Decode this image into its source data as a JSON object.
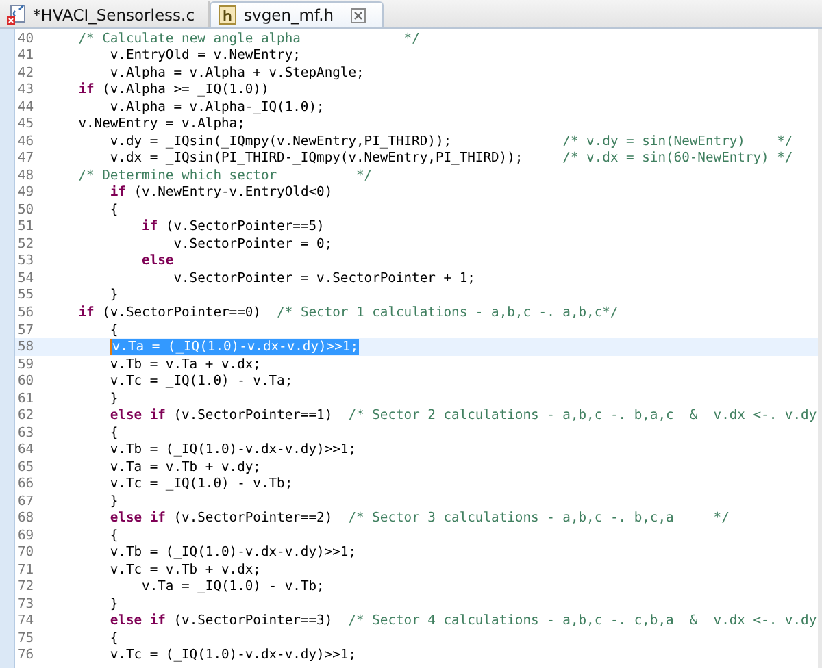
{
  "tabs": [
    {
      "label": "*HVACI_Sensorless.c",
      "selected": false
    },
    {
      "label": "svgen_mf.h",
      "selected": true
    }
  ],
  "editor": {
    "lines": [
      {
        "number": "40",
        "current": false,
        "segments": [
          {
            "kind": "comment",
            "text": "    /* Calculate new angle alpha             */"
          }
        ]
      },
      {
        "number": "41",
        "current": false,
        "segments": [
          {
            "kind": "code",
            "text": "        v.EntryOld = v.NewEntry;"
          }
        ]
      },
      {
        "number": "42",
        "current": false,
        "segments": [
          {
            "kind": "code",
            "text": "        v.Alpha = v.Alpha + v.StepAngle;"
          }
        ]
      },
      {
        "number": "43",
        "current": false,
        "segments": [
          {
            "kind": "keyword",
            "text": "    if"
          },
          {
            "kind": "code",
            "text": " (v.Alpha >= _IQ(1.0))"
          }
        ]
      },
      {
        "number": "44",
        "current": false,
        "segments": [
          {
            "kind": "code",
            "text": "        v.Alpha = v.Alpha-_IQ(1.0);"
          }
        ]
      },
      {
        "number": "45",
        "current": false,
        "segments": [
          {
            "kind": "code",
            "text": "    v.NewEntry = v.Alpha;"
          }
        ]
      },
      {
        "number": "46",
        "current": false,
        "segments": [
          {
            "kind": "code",
            "text": "        v.dy = _IQsin(_IQmpy(v.NewEntry,PI_THIRD));              "
          },
          {
            "kind": "comment",
            "text": "/* v.dy = sin(NewEntry)    */"
          }
        ]
      },
      {
        "number": "47",
        "current": false,
        "segments": [
          {
            "kind": "code",
            "text": "        v.dx = _IQsin(PI_THIRD-_IQmpy(v.NewEntry,PI_THIRD));     "
          },
          {
            "kind": "comment",
            "text": "/* v.dx = sin(60-NewEntry) */"
          }
        ]
      },
      {
        "number": "48",
        "current": false,
        "segments": [
          {
            "kind": "comment",
            "text": "    /* Determine which sector          */"
          }
        ]
      },
      {
        "number": "49",
        "current": false,
        "segments": [
          {
            "kind": "keyword",
            "text": "        if"
          },
          {
            "kind": "code",
            "text": " (v.NewEntry-v.EntryOld<0)"
          }
        ]
      },
      {
        "number": "50",
        "current": false,
        "segments": [
          {
            "kind": "code",
            "text": "        {"
          }
        ]
      },
      {
        "number": "51",
        "current": false,
        "segments": [
          {
            "kind": "keyword",
            "text": "            if"
          },
          {
            "kind": "code",
            "text": " (v.SectorPointer==5)"
          }
        ]
      },
      {
        "number": "52",
        "current": false,
        "segments": [
          {
            "kind": "code",
            "text": "                v.SectorPointer = 0;"
          }
        ]
      },
      {
        "number": "53",
        "current": false,
        "segments": [
          {
            "kind": "keyword",
            "text": "            else"
          }
        ]
      },
      {
        "number": "54",
        "current": false,
        "segments": [
          {
            "kind": "code",
            "text": "                v.SectorPointer = v.SectorPointer + 1;"
          }
        ]
      },
      {
        "number": "55",
        "current": false,
        "segments": [
          {
            "kind": "code",
            "text": "        }"
          }
        ]
      },
      {
        "number": "56",
        "current": false,
        "segments": [
          {
            "kind": "keyword",
            "text": "    if"
          },
          {
            "kind": "code",
            "text": " (v.SectorPointer==0)  "
          },
          {
            "kind": "comment",
            "text": "/* Sector 1 calculations - a,b,c -. a,b,c*/"
          }
        ]
      },
      {
        "number": "57",
        "current": false,
        "segments": [
          {
            "kind": "code",
            "text": "        {"
          }
        ]
      },
      {
        "number": "58",
        "current": true,
        "segments": [
          {
            "kind": "selection",
            "text": "        v.Ta = (_IQ(1.0)-v.dx-v.dy)>>1;"
          }
        ]
      },
      {
        "number": "59",
        "current": false,
        "segments": [
          {
            "kind": "code",
            "text": "        v.Tb = v.Ta + v.dx;"
          }
        ]
      },
      {
        "number": "60",
        "current": false,
        "segments": [
          {
            "kind": "code",
            "text": "        v.Tc = _IQ(1.0) - v.Ta;"
          }
        ]
      },
      {
        "number": "61",
        "current": false,
        "segments": [
          {
            "kind": "code",
            "text": "        }"
          }
        ]
      },
      {
        "number": "62",
        "current": false,
        "segments": [
          {
            "kind": "keyword",
            "text": "        else if"
          },
          {
            "kind": "code",
            "text": " (v.SectorPointer==1)  "
          },
          {
            "kind": "comment",
            "text": "/* Sector 2 calculations - a,b,c -. b,a,c  &  v.dx <-. v.dy"
          }
        ]
      },
      {
        "number": "63",
        "current": false,
        "segments": [
          {
            "kind": "code",
            "text": "        {"
          }
        ]
      },
      {
        "number": "64",
        "current": false,
        "segments": [
          {
            "kind": "code",
            "text": "        v.Tb = (_IQ(1.0)-v.dx-v.dy)>>1;"
          }
        ]
      },
      {
        "number": "65",
        "current": false,
        "segments": [
          {
            "kind": "code",
            "text": "        v.Ta = v.Tb + v.dy;"
          }
        ]
      },
      {
        "number": "66",
        "current": false,
        "segments": [
          {
            "kind": "code",
            "text": "        v.Tc = _IQ(1.0) - v.Tb;"
          }
        ]
      },
      {
        "number": "67",
        "current": false,
        "segments": [
          {
            "kind": "code",
            "text": "        }"
          }
        ]
      },
      {
        "number": "68",
        "current": false,
        "segments": [
          {
            "kind": "keyword",
            "text": "        else if"
          },
          {
            "kind": "code",
            "text": " (v.SectorPointer==2)  "
          },
          {
            "kind": "comment",
            "text": "/* Sector 3 calculations - a,b,c -. b,c,a     */"
          }
        ]
      },
      {
        "number": "69",
        "current": false,
        "segments": [
          {
            "kind": "code",
            "text": "        {"
          }
        ]
      },
      {
        "number": "70",
        "current": false,
        "segments": [
          {
            "kind": "code",
            "text": "        v.Tb = (_IQ(1.0)-v.dx-v.dy)>>1;"
          }
        ]
      },
      {
        "number": "71",
        "current": false,
        "segments": [
          {
            "kind": "code",
            "text": "        v.Tc = v.Tb + v.dx;"
          }
        ]
      },
      {
        "number": "72",
        "current": false,
        "segments": [
          {
            "kind": "code",
            "text": "            v.Ta = _IQ(1.0) - v.Tb;"
          }
        ]
      },
      {
        "number": "73",
        "current": false,
        "segments": [
          {
            "kind": "code",
            "text": "        }"
          }
        ]
      },
      {
        "number": "74",
        "current": false,
        "segments": [
          {
            "kind": "keyword",
            "text": "        else if"
          },
          {
            "kind": "code",
            "text": " (v.SectorPointer==3)  "
          },
          {
            "kind": "comment",
            "text": "/* Sector 4 calculations - a,b,c -. c,b,a  &  v.dx <-. v.dy"
          }
        ]
      },
      {
        "number": "75",
        "current": false,
        "segments": [
          {
            "kind": "code",
            "text": "        {"
          }
        ]
      },
      {
        "number": "76",
        "current": false,
        "segments": [
          {
            "kind": "code",
            "text": "        v.Tc = (_IQ(1.0)-v.dx-v.dy)>>1;"
          }
        ]
      }
    ]
  }
}
